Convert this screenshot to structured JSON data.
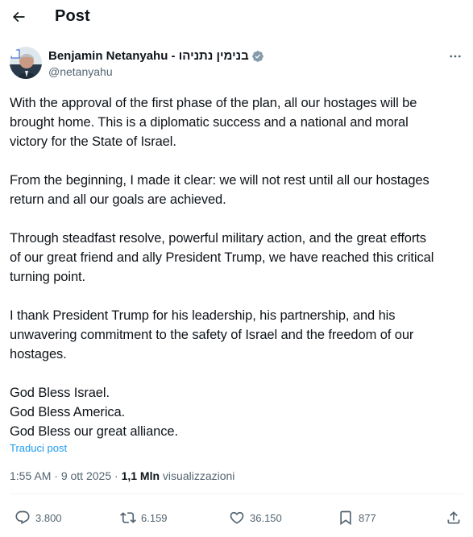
{
  "header": {
    "title": "Post",
    "back_icon": "arrow-left-icon"
  },
  "author": {
    "display_name": "Benjamin Netanyahu - בנימין נתניהו",
    "handle": "@netanyahu",
    "verified_icon": "verified-badge-icon",
    "verified_color": "#829aab"
  },
  "post": {
    "paragraphs": [
      {
        "lines": [
          "With the approval of the first phase of the plan, all our hostages will be",
          "brought home. This is a diplomatic success and a national and moral",
          "victory for the State of Israel."
        ]
      },
      {
        "lines": [
          "From the beginning, I made it clear: we will not rest until all our hostages",
          "return and all our goals are achieved."
        ]
      },
      {
        "lines": [
          "Through steadfast resolve, powerful military action, and the great efforts",
          "of our great friend and ally President Trump, we have reached this critical",
          "turning point."
        ]
      },
      {
        "lines": [
          "I thank President Trump for his leadership, his partnership, and his",
          "unwavering commitment to the safety of Israel and the freedom of our",
          "hostages."
        ]
      },
      {
        "lines": [
          "God Bless Israel.",
          "God Bless America.",
          "God Bless our great alliance."
        ]
      }
    ],
    "translate_label": "Traduci post"
  },
  "meta": {
    "time": "1:55 AM",
    "separator": " · ",
    "date": "9 ott 2025",
    "views_count": "1,1 Mln",
    "views_label": "visualizzazioni"
  },
  "actions": {
    "replies": "3.800",
    "reposts": "6.159",
    "likes": "36.150",
    "bookmarks": "877"
  },
  "colors": {
    "text": "#0f1419",
    "secondary": "#536471",
    "link": "#1d9bf0",
    "divider": "#eff3f4"
  }
}
